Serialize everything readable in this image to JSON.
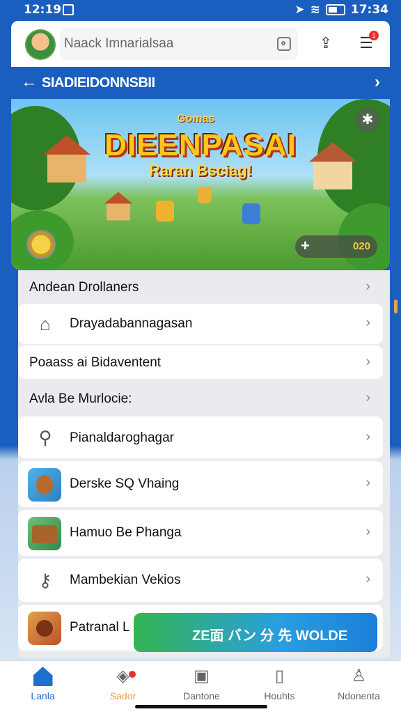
{
  "status_bar": {
    "time": "12:19",
    "right_time": "17:34"
  },
  "header": {
    "search_placeholder": "Naack Imnarialsaa"
  },
  "title_bar": {
    "title": "SIADIEIDONNSBII"
  },
  "banner": {
    "small_title": "Gomas",
    "game_title": "DIEENPASAI",
    "subtitle": "Raran Bsciag!",
    "currency": "020"
  },
  "list": {
    "section_1": "Andean Drollaners",
    "items_1": [
      {
        "label": "Drayadabannagasan",
        "icon": "tag-icon"
      },
      {
        "label": "Poaass ai Bidaventent",
        "icon": ""
      }
    ],
    "section_2": "Avla Be Murlocie:",
    "items_2": [
      {
        "label": "Pianaldaroghagar",
        "icon": "search-icon"
      },
      {
        "label": "Derske SQ Vhaing",
        "icon": "game-thumb-monkey"
      },
      {
        "label": "Hamuo Be Phanga",
        "icon": "game-thumb-chest"
      },
      {
        "label": "Mambekian Vekios",
        "icon": "key-icon"
      },
      {
        "label": "Patranal L",
        "icon": "game-thumb-map"
      }
    ]
  },
  "toast": {
    "text": "ZE面 バン 分 先  WOLDE"
  },
  "bottom_nav": [
    {
      "label": "Lanla",
      "icon": "home-icon",
      "active": true
    },
    {
      "label": "Sador",
      "icon": "tag-icon",
      "active": false
    },
    {
      "label": "Dantone",
      "icon": "box-icon",
      "active": false
    },
    {
      "label": "Houhts",
      "icon": "bookmark-icon",
      "active": false
    },
    {
      "label": "Ndonenta",
      "icon": "profile-icon",
      "active": false
    }
  ],
  "colors": {
    "primary": "#1a5fc0",
    "accent": "#1f6fd0",
    "badge": "#e5322d"
  }
}
